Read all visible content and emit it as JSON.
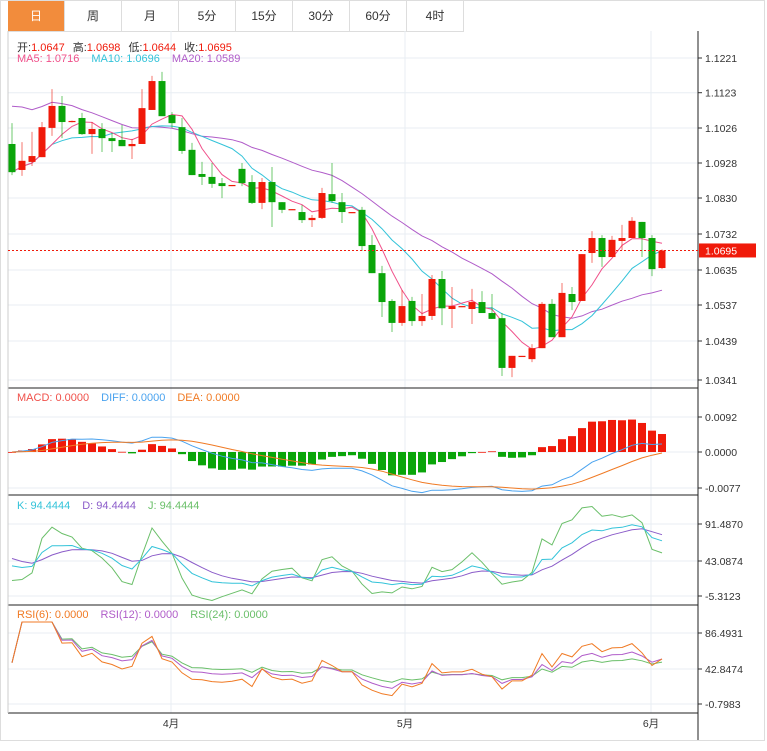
{
  "tabs": [
    {
      "label": "日",
      "active": true
    },
    {
      "label": "周"
    },
    {
      "label": "月"
    },
    {
      "label": "5分"
    },
    {
      "label": "15分"
    },
    {
      "label": "30分"
    },
    {
      "label": "60分"
    },
    {
      "label": "4时"
    }
  ],
  "legend": {
    "ohlc": [
      {
        "label": "开:",
        "value": "1.0647"
      },
      {
        "label": "高:",
        "value": "1.0698"
      },
      {
        "label": "低:",
        "value": "1.0644"
      },
      {
        "label": "收:",
        "value": "1.0695"
      }
    ],
    "ma": [
      {
        "text": "MA5: 1.0716",
        "color": "#f0508a"
      },
      {
        "text": "MA10: 1.0696",
        "color": "#33c3d9"
      },
      {
        "text": "MA20: 1.0589",
        "color": "#b05cc9"
      }
    ],
    "macd": [
      {
        "text": "MACD: 0.0000",
        "color": "#f0504a"
      },
      {
        "text": "DIFF: 0.0000",
        "color": "#4aa3ef"
      },
      {
        "text": "DEA: 0.0000",
        "color": "#f07a24"
      }
    ],
    "kdj": [
      {
        "text": "K: 94.4444",
        "color": "#33c3d9"
      },
      {
        "text": "D: 94.4444",
        "color": "#8b5cc9"
      },
      {
        "text": "J: 94.4444",
        "color": "#6abf69"
      }
    ],
    "rsi": [
      {
        "text": "RSI(6): 0.0000",
        "color": "#f07a24"
      },
      {
        "text": "RSI(12): 0.0000",
        "color": "#b05cc9"
      },
      {
        "text": "RSI(24): 0.0000",
        "color": "#6abf69"
      }
    ]
  },
  "colors": {
    "up": "#f01a0a",
    "down": "#0aa50a",
    "tab_active": "#f28c3c"
  },
  "current_price": "1.0695",
  "chart_data": {
    "type": "candlestick",
    "price_ticks": [
      "1.1221",
      "1.1123",
      "1.1026",
      "1.0928",
      "1.0830",
      "1.0732",
      "1.0635",
      "1.0537",
      "1.0439",
      "1.0341"
    ],
    "price_range": [
      1.0341,
      1.1221
    ],
    "macd_ticks": [
      "0.0092",
      "0.0000",
      "-0.0077"
    ],
    "kdj_ticks": [
      "91.4870",
      "43.0874",
      "-5.3123"
    ],
    "rsi_ticks": [
      "86.4931",
      "42.8474",
      "-0.7983"
    ],
    "months": [
      {
        "label": "4月",
        "index": 15.9
      },
      {
        "label": "5月",
        "index": 39.3
      },
      {
        "label": "6月",
        "index": 63.9
      }
    ],
    "ohlc": [
      [
        1.0986,
        1.1043,
        1.0901,
        1.0909
      ],
      [
        1.0915,
        1.0991,
        1.0899,
        1.094
      ],
      [
        1.0937,
        1.1019,
        1.0926,
        1.0953
      ],
      [
        1.095,
        1.1046,
        1.095,
        1.1032
      ],
      [
        1.103,
        1.1136,
        1.1008,
        1.109
      ],
      [
        1.109,
        1.1117,
        1.1002,
        1.1046
      ],
      [
        1.1046,
        1.105,
        1.1045,
        1.1049
      ],
      [
        1.1057,
        1.1071,
        1.1011,
        1.1013
      ],
      [
        1.1013,
        1.1046,
        1.0959,
        1.1027
      ],
      [
        1.1027,
        1.1043,
        1.0964,
        1.1002
      ],
      [
        1.1002,
        1.1016,
        1.0964,
        1.0994
      ],
      [
        1.0997,
        1.1038,
        1.098,
        1.098
      ],
      [
        1.098,
        1.1,
        1.0945,
        1.0986
      ],
      [
        1.0986,
        1.1136,
        1.0986,
        1.1084
      ],
      [
        1.1079,
        1.1172,
        1.1079,
        1.1158
      ],
      [
        1.1158,
        1.1183,
        1.1062,
        1.1062
      ],
      [
        1.1065,
        1.1073,
        1.103,
        1.1043
      ],
      [
        1.1032,
        1.1057,
        1.0959,
        1.0967
      ],
      [
        1.097,
        1.0989,
        1.0901,
        1.0901
      ],
      [
        1.0904,
        1.0937,
        1.0874,
        1.0896
      ],
      [
        1.0896,
        1.0934,
        1.0866,
        1.0877
      ],
      [
        1.0879,
        1.0893,
        1.0838,
        1.0871
      ],
      [
        1.0871,
        1.0874,
        1.0871,
        1.0874
      ],
      [
        1.0918,
        1.0934,
        1.0871,
        1.0879
      ],
      [
        1.0882,
        1.0901,
        1.0822,
        1.0825
      ],
      [
        1.0825,
        1.0893,
        1.0808,
        1.0882
      ],
      [
        1.0882,
        1.0923,
        1.0759,
        1.0827
      ],
      [
        1.0827,
        1.0827,
        1.0797,
        1.0806
      ],
      [
        1.0806,
        1.0808,
        1.0806,
        1.0808
      ],
      [
        1.08,
        1.0819,
        1.077,
        1.0778
      ],
      [
        1.0778,
        1.0792,
        1.0759,
        1.0784
      ],
      [
        1.0784,
        1.0866,
        1.0781,
        1.0852
      ],
      [
        1.0849,
        1.0934,
        1.0825,
        1.083
      ],
      [
        1.0827,
        1.0852,
        1.077,
        1.08
      ],
      [
        1.0797,
        1.08,
        1.0797,
        1.08
      ],
      [
        1.0806,
        1.0814,
        1.0694,
        1.0707
      ],
      [
        1.071,
        1.0737,
        1.0633,
        1.0633
      ],
      [
        1.0633,
        1.0653,
        1.0513,
        1.0554
      ],
      [
        1.0557,
        1.0562,
        1.0472,
        1.0497
      ],
      [
        1.0497,
        1.0587,
        1.0489,
        1.0543
      ],
      [
        1.0557,
        1.0568,
        1.0489,
        1.0502
      ],
      [
        1.0502,
        1.0576,
        1.0489,
        1.0516
      ],
      [
        1.0516,
        1.0628,
        1.0505,
        1.0617
      ],
      [
        1.0617,
        1.0639,
        1.0491,
        1.0537
      ],
      [
        1.0535,
        1.0595,
        1.0483,
        1.0543
      ],
      [
        1.054,
        1.0543,
        1.054,
        1.0543
      ],
      [
        1.0535,
        1.059,
        1.0494,
        1.0554
      ],
      [
        1.0554,
        1.0584,
        1.0524,
        1.0524
      ],
      [
        1.0524,
        1.0576,
        1.0508,
        1.0508
      ],
      [
        1.051,
        1.0524,
        1.0352,
        1.0374
      ],
      [
        1.0374,
        1.0407,
        1.0349,
        1.0407
      ],
      [
        1.0404,
        1.0407,
        1.0404,
        1.0407
      ],
      [
        1.0398,
        1.0439,
        1.039,
        1.0428
      ],
      [
        1.0428,
        1.0554,
        1.0428,
        1.0549
      ],
      [
        1.0549,
        1.0562,
        1.0458,
        1.0458
      ],
      [
        1.0458,
        1.0606,
        1.0458,
        1.0579
      ],
      [
        1.0576,
        1.0595,
        1.0532,
        1.0554
      ],
      [
        1.0557,
        1.0685,
        1.0557,
        1.0685
      ],
      [
        1.0688,
        1.0748,
        1.0661,
        1.0729
      ],
      [
        1.0729,
        1.0737,
        1.065,
        1.0677
      ],
      [
        1.0677,
        1.0735,
        1.0677,
        1.0724
      ],
      [
        1.0721,
        1.0765,
        1.0696,
        1.0729
      ],
      [
        1.0729,
        1.0786,
        1.0729,
        1.0776
      ],
      [
        1.0773,
        1.0773,
        1.0677,
        1.0729
      ],
      [
        1.0729,
        1.0737,
        1.0625,
        1.0644
      ],
      [
        1.0647,
        1.0698,
        1.0644,
        1.0695
      ]
    ]
  }
}
